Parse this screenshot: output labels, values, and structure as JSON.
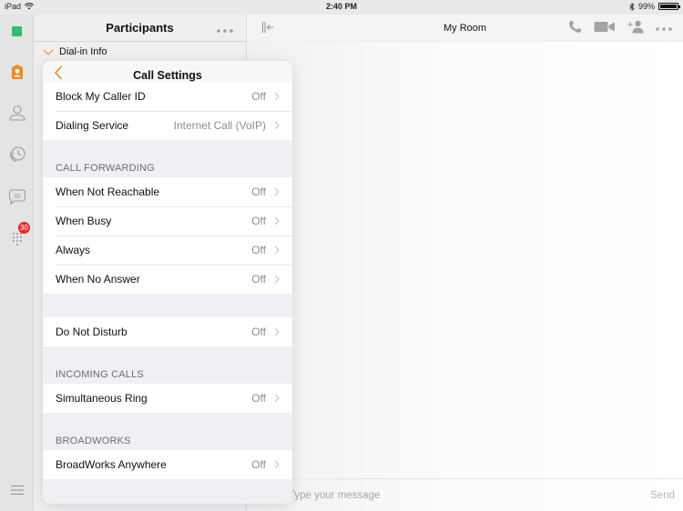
{
  "status_bar": {
    "device": "iPad",
    "time": "2:40 PM",
    "battery": "99%",
    "battery_level": 0.99
  },
  "rail": {
    "items": [
      {
        "name": "status",
        "icon": "presence-square-icon",
        "color": "#2dbf6d"
      },
      {
        "name": "contacts",
        "icon": "contact-card-icon",
        "active": true,
        "color": "#ef8b1f"
      },
      {
        "name": "people",
        "icon": "person-icon"
      },
      {
        "name": "call-history",
        "icon": "call-history-icon"
      },
      {
        "name": "messages",
        "icon": "chat-bubble-icon"
      },
      {
        "name": "dialpad",
        "icon": "dialpad-icon",
        "badge": "30"
      }
    ],
    "menu_icon": "hamburger-icon"
  },
  "participants": {
    "title": "Participants",
    "more": "•••",
    "dial_in_label": "Dial-in Info"
  },
  "room": {
    "title": "My Room",
    "composer_placeholder": "Type your message",
    "send_label": "Send"
  },
  "call_settings": {
    "title": "Call Settings",
    "accent_color": "#ef8b1f",
    "top_rows": [
      {
        "label": "Block My Caller ID",
        "value": "Off"
      },
      {
        "label": "Dialing Service",
        "value": "Internet Call (VoIP)"
      }
    ],
    "call_forwarding": {
      "header": "CALL FORWARDING",
      "rows": [
        {
          "label": "When Not Reachable",
          "value": "Off"
        },
        {
          "label": "When Busy",
          "value": "Off"
        },
        {
          "label": "Always",
          "value": "Off"
        },
        {
          "label": "When No Answer",
          "value": "Off"
        }
      ]
    },
    "dnd_rows": [
      {
        "label": "Do Not Disturb",
        "value": "Off"
      }
    ],
    "incoming_calls": {
      "header": "INCOMING CALLS",
      "rows": [
        {
          "label": "Simultaneous Ring",
          "value": "Off"
        }
      ]
    },
    "broadworks": {
      "header": "BROADWORKS",
      "rows": [
        {
          "label": "BroadWorks Anywhere",
          "value": "Off"
        }
      ]
    }
  }
}
